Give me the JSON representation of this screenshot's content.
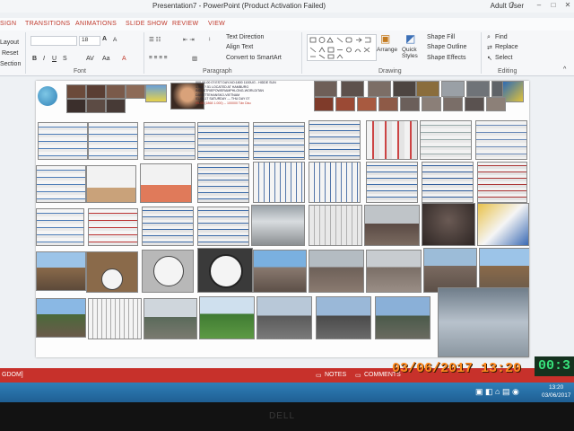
{
  "window": {
    "title": "Presentation7 - PowerPoint (Product Activation Failed)",
    "user": "Adult User",
    "help": "?",
    "minimize": "–",
    "maximize": "□",
    "close": "✕"
  },
  "tabs": [
    "SIGN",
    "TRANSITIONS",
    "ANIMATIONS",
    "SLIDE SHOW",
    "REVIEW",
    "VIEW"
  ],
  "ribbon": {
    "slides": {
      "layout": "Layout",
      "reset": "Reset",
      "section": "Section"
    },
    "font": {
      "size": "18",
      "grow": "A",
      "shrink": "A",
      "label": "Font"
    },
    "paragraph": {
      "text_direction": "Text Direction",
      "align_text": "Align Text",
      "convert_smartart": "Convert to SmartArt",
      "label": "Paragraph"
    },
    "drawing": {
      "arrange": "Arrange",
      "quick_styles": "Quick Styles",
      "shape_fill": "Shape Fill",
      "shape_outline": "Shape Outline",
      "shape_effects": "Shape Effects",
      "label": "Drawing"
    },
    "editing": {
      "find": "Find",
      "replace": "Replace",
      "select": "Select",
      "label": "Editing"
    }
  },
  "slide_text": {
    "l1": "000-00-00 07:EST DAY-NO:1800 1100UG - HIDDE SUN",
    "l2": "1,000 ?.51 LOCATED AT HAMBURG",
    "l3": "INDUSTRIEPOWERAMPHLONG-WORLDITAN",
    "l4": "DANETTEHANSKO-VIETNAM",
    "l5": "01-06-17 SATURDAY --- THU DAY 07",
    "l6": "09-05 (1868 1.000) -- 100000 Tấn Dầu"
  },
  "status": {
    "left": "GDOM]",
    "notes": "NOTES",
    "comments": "COMMENTS"
  },
  "taskbar": {
    "time": "13:20",
    "date": "03/06/2017"
  },
  "overlay": {
    "stamp": "03/06/2017 13:20",
    "timer": "00:3"
  },
  "monitor": {
    "brand": "DELL"
  }
}
